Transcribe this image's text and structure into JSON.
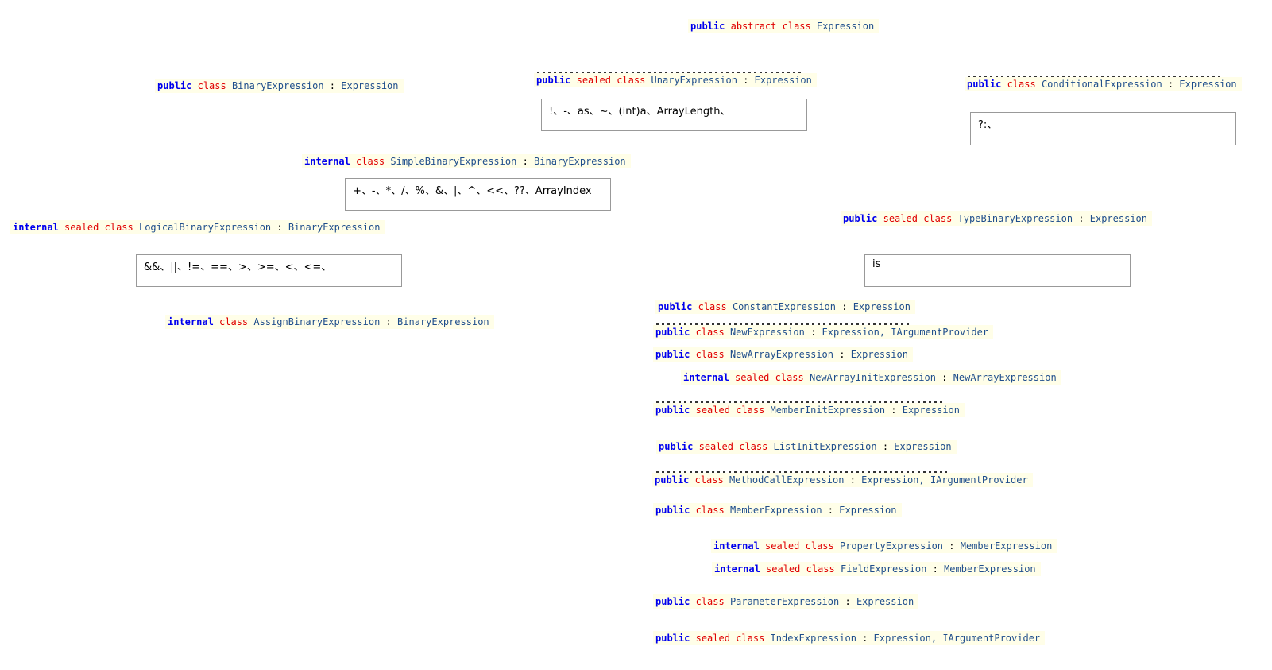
{
  "nodes": {
    "expression": {
      "modifiers": [
        "public",
        "abstract",
        "class"
      ],
      "name": "Expression",
      "base": ""
    },
    "binary": {
      "modifiers": [
        "public",
        "class"
      ],
      "name": "BinaryExpression",
      "base": "Expression"
    },
    "unary": {
      "modifiers": [
        "public",
        "sealed",
        "class"
      ],
      "name": "UnaryExpression",
      "base": "Expression"
    },
    "conditional": {
      "modifiers": [
        "public",
        "class"
      ],
      "name": "ConditionalExpression",
      "base": "Expression"
    },
    "simple_binary": {
      "modifiers": [
        "internal",
        "class"
      ],
      "name": "SimpleBinaryExpression",
      "base": "BinaryExpression"
    },
    "logical_binary": {
      "modifiers": [
        "internal",
        "sealed",
        "class"
      ],
      "name": "LogicalBinaryExpression",
      "base": "BinaryExpression"
    },
    "assign_binary": {
      "modifiers": [
        "internal",
        "class"
      ],
      "name": "AssignBinaryExpression",
      "base": "BinaryExpression"
    },
    "type_binary": {
      "modifiers": [
        "public",
        "sealed",
        "class"
      ],
      "name": "TypeBinaryExpression",
      "base": "Expression"
    },
    "constant": {
      "modifiers": [
        "public",
        "class"
      ],
      "name": "ConstantExpression",
      "base": "Expression"
    },
    "new": {
      "modifiers": [
        "public",
        "class"
      ],
      "name": "NewExpression",
      "base": "Expression, IArgumentProvider"
    },
    "new_array": {
      "modifiers": [
        "public",
        "class"
      ],
      "name": "NewArrayExpression",
      "base": "Expression"
    },
    "new_array_init": {
      "modifiers": [
        "internal",
        "sealed",
        "class"
      ],
      "name": "NewArrayInitExpression",
      "base": "NewArrayExpression"
    },
    "member_init": {
      "modifiers": [
        "public",
        "sealed",
        "class"
      ],
      "name": "MemberInitExpression",
      "base": "Expression"
    },
    "list_init": {
      "modifiers": [
        "public",
        "sealed",
        "class"
      ],
      "name": "ListInitExpression",
      "base": "Expression"
    },
    "method_call": {
      "modifiers": [
        "public",
        "class"
      ],
      "name": "MethodCallExpression",
      "base": "Expression, IArgumentProvider"
    },
    "member": {
      "modifiers": [
        "public",
        "class"
      ],
      "name": "MemberExpression",
      "base": "Expression"
    },
    "property": {
      "modifiers": [
        "internal",
        "sealed",
        "class"
      ],
      "name": "PropertyExpression",
      "base": "MemberExpression"
    },
    "field": {
      "modifiers": [
        "internal",
        "sealed",
        "class"
      ],
      "name": "FieldExpression",
      "base": "MemberExpression"
    },
    "parameter": {
      "modifiers": [
        "public",
        "class"
      ],
      "name": "ParameterExpression",
      "base": "Expression"
    },
    "index": {
      "modifiers": [
        "public",
        "sealed",
        "class"
      ],
      "name": "IndexExpression",
      "base": "Expression, IArgumentProvider"
    }
  },
  "operator_boxes": {
    "unary_ops": "!、-、as、~、(int)a、ArrayLength、",
    "conditional_ops": "?:、",
    "simple_binary_ops": "+、-、*、/、%、&、|、^、<<、??、ArrayIndex",
    "logical_binary_ops": "&&、||、!=、==、>、>=、<、<=、",
    "type_binary_ops": "is"
  },
  "colors": {
    "declaration_bg": "#fffee8",
    "access_keyword": "#0000ee",
    "modifier_keyword": "#e00000",
    "type_name": "#1f4e8c",
    "box_border": "#999999"
  }
}
